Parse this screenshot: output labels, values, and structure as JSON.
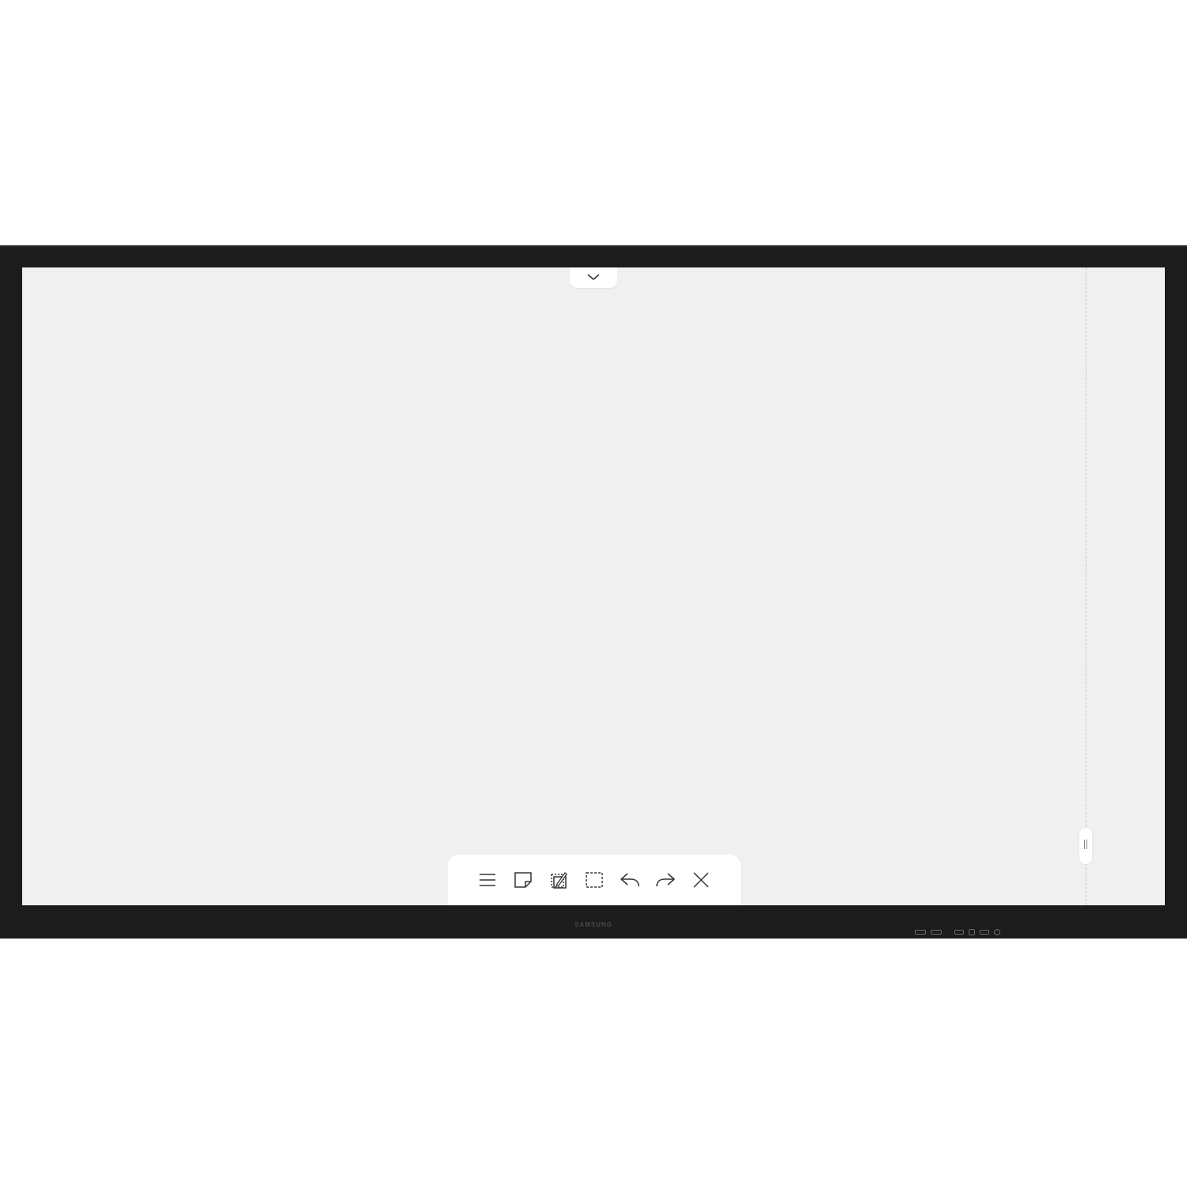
{
  "device": {
    "brand_label": "SAMSUNG"
  },
  "icons": {
    "top_handle": "chevron-down-icon",
    "side_handle": "drag-handle-icon"
  },
  "toolbar": {
    "items": [
      {
        "name": "menu",
        "icon": "hamburger-menu-icon"
      },
      {
        "name": "sticky-note",
        "icon": "sticky-note-icon"
      },
      {
        "name": "import-edit",
        "icon": "edit-page-icon"
      },
      {
        "name": "select",
        "icon": "select-area-icon"
      },
      {
        "name": "undo",
        "icon": "undo-icon"
      },
      {
        "name": "redo",
        "icon": "redo-icon"
      },
      {
        "name": "close",
        "icon": "close-icon"
      }
    ]
  },
  "colors": {
    "bezel": "#1c1c1c",
    "canvas": "#f0f0f0",
    "panel": "#ffffff",
    "icon_stroke": "#333333"
  }
}
